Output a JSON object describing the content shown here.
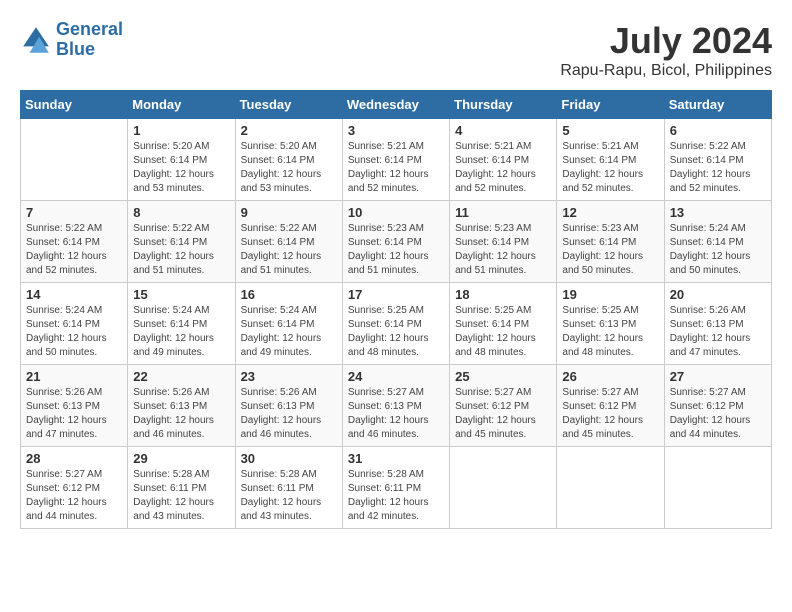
{
  "header": {
    "logo_line1": "General",
    "logo_line2": "Blue",
    "month_year": "July 2024",
    "location": "Rapu-Rapu, Bicol, Philippines"
  },
  "weekdays": [
    "Sunday",
    "Monday",
    "Tuesday",
    "Wednesday",
    "Thursday",
    "Friday",
    "Saturday"
  ],
  "weeks": [
    [
      {
        "day": "",
        "info": ""
      },
      {
        "day": "1",
        "info": "Sunrise: 5:20 AM\nSunset: 6:14 PM\nDaylight: 12 hours\nand 53 minutes."
      },
      {
        "day": "2",
        "info": "Sunrise: 5:20 AM\nSunset: 6:14 PM\nDaylight: 12 hours\nand 53 minutes."
      },
      {
        "day": "3",
        "info": "Sunrise: 5:21 AM\nSunset: 6:14 PM\nDaylight: 12 hours\nand 52 minutes."
      },
      {
        "day": "4",
        "info": "Sunrise: 5:21 AM\nSunset: 6:14 PM\nDaylight: 12 hours\nand 52 minutes."
      },
      {
        "day": "5",
        "info": "Sunrise: 5:21 AM\nSunset: 6:14 PM\nDaylight: 12 hours\nand 52 minutes."
      },
      {
        "day": "6",
        "info": "Sunrise: 5:22 AM\nSunset: 6:14 PM\nDaylight: 12 hours\nand 52 minutes."
      }
    ],
    [
      {
        "day": "7",
        "info": "Sunrise: 5:22 AM\nSunset: 6:14 PM\nDaylight: 12 hours\nand 52 minutes."
      },
      {
        "day": "8",
        "info": "Sunrise: 5:22 AM\nSunset: 6:14 PM\nDaylight: 12 hours\nand 51 minutes."
      },
      {
        "day": "9",
        "info": "Sunrise: 5:22 AM\nSunset: 6:14 PM\nDaylight: 12 hours\nand 51 minutes."
      },
      {
        "day": "10",
        "info": "Sunrise: 5:23 AM\nSunset: 6:14 PM\nDaylight: 12 hours\nand 51 minutes."
      },
      {
        "day": "11",
        "info": "Sunrise: 5:23 AM\nSunset: 6:14 PM\nDaylight: 12 hours\nand 51 minutes."
      },
      {
        "day": "12",
        "info": "Sunrise: 5:23 AM\nSunset: 6:14 PM\nDaylight: 12 hours\nand 50 minutes."
      },
      {
        "day": "13",
        "info": "Sunrise: 5:24 AM\nSunset: 6:14 PM\nDaylight: 12 hours\nand 50 minutes."
      }
    ],
    [
      {
        "day": "14",
        "info": "Sunrise: 5:24 AM\nSunset: 6:14 PM\nDaylight: 12 hours\nand 50 minutes."
      },
      {
        "day": "15",
        "info": "Sunrise: 5:24 AM\nSunset: 6:14 PM\nDaylight: 12 hours\nand 49 minutes."
      },
      {
        "day": "16",
        "info": "Sunrise: 5:24 AM\nSunset: 6:14 PM\nDaylight: 12 hours\nand 49 minutes."
      },
      {
        "day": "17",
        "info": "Sunrise: 5:25 AM\nSunset: 6:14 PM\nDaylight: 12 hours\nand 48 minutes."
      },
      {
        "day": "18",
        "info": "Sunrise: 5:25 AM\nSunset: 6:14 PM\nDaylight: 12 hours\nand 48 minutes."
      },
      {
        "day": "19",
        "info": "Sunrise: 5:25 AM\nSunset: 6:13 PM\nDaylight: 12 hours\nand 48 minutes."
      },
      {
        "day": "20",
        "info": "Sunrise: 5:26 AM\nSunset: 6:13 PM\nDaylight: 12 hours\nand 47 minutes."
      }
    ],
    [
      {
        "day": "21",
        "info": "Sunrise: 5:26 AM\nSunset: 6:13 PM\nDaylight: 12 hours\nand 47 minutes."
      },
      {
        "day": "22",
        "info": "Sunrise: 5:26 AM\nSunset: 6:13 PM\nDaylight: 12 hours\nand 46 minutes."
      },
      {
        "day": "23",
        "info": "Sunrise: 5:26 AM\nSunset: 6:13 PM\nDaylight: 12 hours\nand 46 minutes."
      },
      {
        "day": "24",
        "info": "Sunrise: 5:27 AM\nSunset: 6:13 PM\nDaylight: 12 hours\nand 46 minutes."
      },
      {
        "day": "25",
        "info": "Sunrise: 5:27 AM\nSunset: 6:12 PM\nDaylight: 12 hours\nand 45 minutes."
      },
      {
        "day": "26",
        "info": "Sunrise: 5:27 AM\nSunset: 6:12 PM\nDaylight: 12 hours\nand 45 minutes."
      },
      {
        "day": "27",
        "info": "Sunrise: 5:27 AM\nSunset: 6:12 PM\nDaylight: 12 hours\nand 44 minutes."
      }
    ],
    [
      {
        "day": "28",
        "info": "Sunrise: 5:27 AM\nSunset: 6:12 PM\nDaylight: 12 hours\nand 44 minutes."
      },
      {
        "day": "29",
        "info": "Sunrise: 5:28 AM\nSunset: 6:11 PM\nDaylight: 12 hours\nand 43 minutes."
      },
      {
        "day": "30",
        "info": "Sunrise: 5:28 AM\nSunset: 6:11 PM\nDaylight: 12 hours\nand 43 minutes."
      },
      {
        "day": "31",
        "info": "Sunrise: 5:28 AM\nSunset: 6:11 PM\nDaylight: 12 hours\nand 42 minutes."
      },
      {
        "day": "",
        "info": ""
      },
      {
        "day": "",
        "info": ""
      },
      {
        "day": "",
        "info": ""
      }
    ]
  ]
}
